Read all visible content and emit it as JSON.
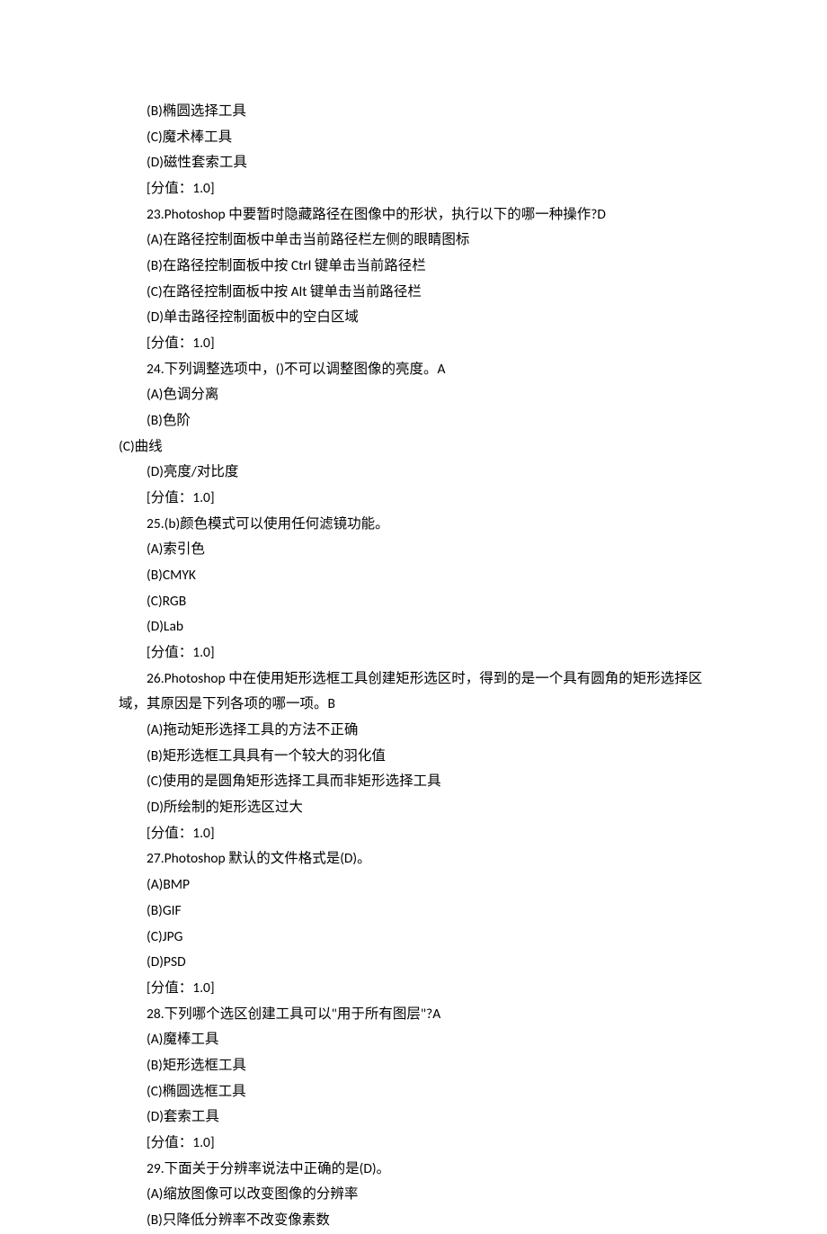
{
  "lines": [
    {
      "indent": true,
      "text": "(B)椭圆选择工具"
    },
    {
      "indent": true,
      "text": "(C)魔术棒工具"
    },
    {
      "indent": true,
      "text": "(D)磁性套索工具"
    },
    {
      "indent": true,
      "text": "[分值：1.0]"
    },
    {
      "indent": true,
      "text": "23.Photoshop 中要暂时隐藏路径在图像中的形状，执行以下的哪一种操作?D"
    },
    {
      "indent": true,
      "text": "(A)在路径控制面板中单击当前路径栏左侧的眼睛图标"
    },
    {
      "indent": true,
      "text": "(B)在路径控制面板中按 Ctrl 键单击当前路径栏"
    },
    {
      "indent": true,
      "text": "(C)在路径控制面板中按 Alt 键单击当前路径栏"
    },
    {
      "indent": true,
      "text": "(D)单击路径控制面板中的空白区域"
    },
    {
      "indent": true,
      "text": "[分值：1.0]"
    },
    {
      "indent": true,
      "text": "24.下列调整选项中，()不可以调整图像的亮度。A"
    },
    {
      "indent": true,
      "text": "(A)色调分离"
    },
    {
      "indent": true,
      "text": "(B)色阶"
    },
    {
      "indent": false,
      "text": "(C)曲线"
    },
    {
      "indent": true,
      "text": "(D)亮度/对比度"
    },
    {
      "indent": true,
      "text": "[分值：1.0]"
    },
    {
      "indent": true,
      "text": "25.(b)颜色模式可以使用任何滤镜功能。"
    },
    {
      "indent": true,
      "text": "(A)索引色"
    },
    {
      "indent": true,
      "text": "(B)CMYK"
    },
    {
      "indent": true,
      "text": "(C)RGB"
    },
    {
      "indent": true,
      "text": "(D)Lab"
    },
    {
      "indent": true,
      "text": "[分值：1.0]"
    },
    {
      "indent": true,
      "text": "26.Photoshop 中在使用矩形选框工具创建矩形选区时，得到的是一个具有圆角的矩形选择区域，其原因是下列各项的哪一项。B"
    },
    {
      "indent": true,
      "text": "(A)拖动矩形选择工具的方法不正确"
    },
    {
      "indent": true,
      "text": "(B)矩形选框工具具有一个较大的羽化值"
    },
    {
      "indent": true,
      "text": "(C)使用的是圆角矩形选择工具而非矩形选择工具"
    },
    {
      "indent": true,
      "text": "(D)所绘制的矩形选区过大"
    },
    {
      "indent": true,
      "text": "[分值：1.0]"
    },
    {
      "indent": true,
      "text": "27.Photoshop 默认的文件格式是(D)。"
    },
    {
      "indent": true,
      "text": "(A)BMP"
    },
    {
      "indent": true,
      "text": "(B)GIF"
    },
    {
      "indent": true,
      "text": "(C)JPG"
    },
    {
      "indent": true,
      "text": "(D)PSD"
    },
    {
      "indent": true,
      "text": "[分值：1.0]"
    },
    {
      "indent": true,
      "text": "28.下列哪个选区创建工具可以\"用于所有图层\"?A"
    },
    {
      "indent": true,
      "text": "(A)魔棒工具"
    },
    {
      "indent": true,
      "text": "(B)矩形选框工具"
    },
    {
      "indent": true,
      "text": "(C)椭圆选框工具"
    },
    {
      "indent": true,
      "text": "(D)套索工具"
    },
    {
      "indent": true,
      "text": "[分值：1.0]"
    },
    {
      "indent": true,
      "text": "29.下面关于分辨率说法中正确的是(D)。"
    },
    {
      "indent": true,
      "text": "(A)缩放图像可以改变图像的分辨率"
    },
    {
      "indent": true,
      "text": "(B)只降低分辨率不改变像素数"
    }
  ]
}
